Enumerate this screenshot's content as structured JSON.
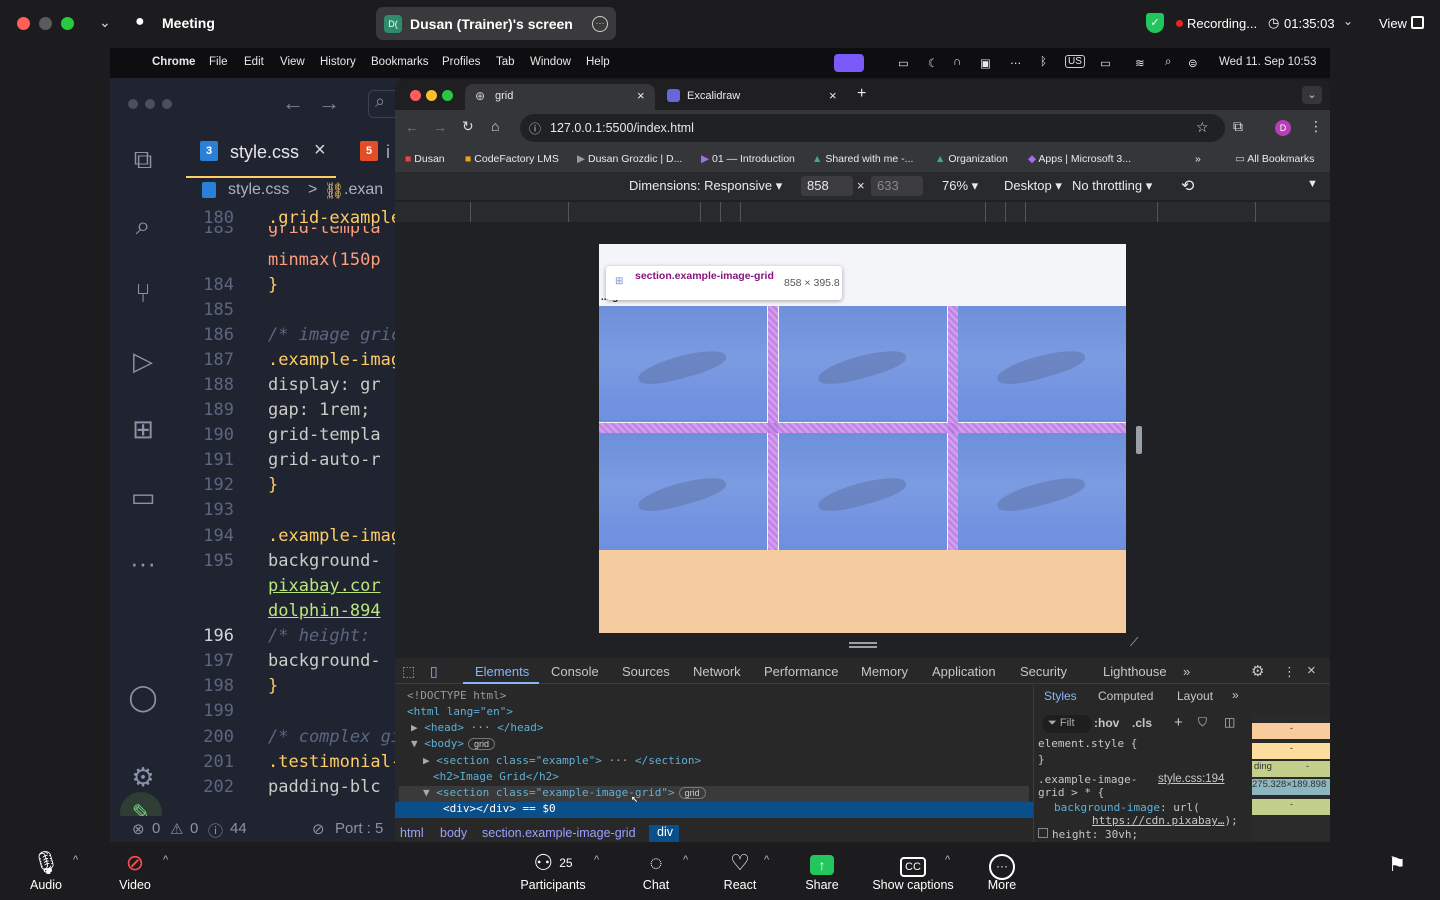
{
  "zoom": {
    "meeting_label": "Meeting",
    "screen_share_label": "Dusan (Trainer)'s screen",
    "recording_label": "Recording...",
    "timer": "01:35:03",
    "view_label": "View",
    "bottom": {
      "audio": "Audio",
      "video": "Video",
      "participants": "Participants",
      "participants_count": "25",
      "chat": "Chat",
      "react": "React",
      "share": "Share",
      "captions": "Show captions",
      "more": "More"
    }
  },
  "mac_menubar": {
    "app": "Chrome",
    "menus": [
      "File",
      "Edit",
      "View",
      "History",
      "Bookmarks",
      "Profiles",
      "Tab",
      "Window",
      "Help"
    ],
    "datetime": "Wed 11. Sep  10:53"
  },
  "vscode": {
    "tabs": [
      {
        "label": "style.css"
      },
      {
        "label": "i"
      }
    ],
    "breadcrumb_file": "style.css",
    "breadcrumb_sep": ">",
    "breadcrumb_symbol": ".exan",
    "lines": [
      {
        "n": "180",
        "code": ".grid-example"
      },
      {
        "n": "183",
        "code": "  grid-templa"
      },
      {
        "n": "",
        "code": "  minmax(150p"
      },
      {
        "n": "184",
        "code": "}"
      },
      {
        "n": "185",
        "code": ""
      },
      {
        "n": "186",
        "code": "/* image gric"
      },
      {
        "n": "187",
        "code": ".example-imag"
      },
      {
        "n": "188",
        "code": "  display: gr"
      },
      {
        "n": "189",
        "code": "  gap: 1rem;"
      },
      {
        "n": "190",
        "code": "  grid-templa"
      },
      {
        "n": "191",
        "code": "  grid-auto-r"
      },
      {
        "n": "192",
        "code": "}"
      },
      {
        "n": "193",
        "code": ""
      },
      {
        "n": "194",
        "code": ".example-imag"
      },
      {
        "n": "195",
        "code": "  background-"
      },
      {
        "n": "",
        "code": "  pixabay.cor"
      },
      {
        "n": "",
        "code": "  dolphin-894"
      },
      {
        "n": "196",
        "code": "  /* height: "
      },
      {
        "n": "197",
        "code": "  background-"
      },
      {
        "n": "198",
        "code": "}"
      },
      {
        "n": "199",
        "code": ""
      },
      {
        "n": "200",
        "code": "/* complex gi"
      },
      {
        "n": "201",
        "code": ".testimonial-"
      },
      {
        "n": "202",
        "code": "  padding-blc"
      }
    ],
    "status": {
      "errors": "0",
      "warnings": "0",
      "info": "44",
      "port": "Port : 5"
    }
  },
  "chrome": {
    "tabs": [
      {
        "label": "grid"
      },
      {
        "label": "Excalidraw"
      }
    ],
    "url": "127.0.0.1:5500/index.html",
    "profile_initial": "D",
    "bookmarks": [
      "Dusan",
      "CodeFactory LMS",
      "Dusan Grozdic | D...",
      "01 — Introduction",
      "Shared with me -...",
      "Organization",
      "Apps | Microsoft 3..."
    ],
    "all_bookmarks": "All Bookmarks",
    "device_toolbar": {
      "dimensions_label": "Dimensions: Responsive",
      "width": "858",
      "height": "633",
      "zoom": "76%",
      "device": "Desktop",
      "throttle": "No throttling"
    },
    "page": {
      "heading_partial": "... ge Grid",
      "tooltip_selector": "section.example-image-grid",
      "tooltip_size": "858 × 395.8"
    },
    "devtools": {
      "tabs": [
        "Elements",
        "Console",
        "Sources",
        "Network",
        "Performance",
        "Memory",
        "Application",
        "Security",
        "Lighthouse"
      ],
      "dom": [
        "<!DOCTYPE html>",
        "<html lang=\"en\">",
        "<head>",
        "</head>",
        "<body>",
        "<section class=\"example\">",
        "</section>",
        "<h2>Image Grid</h2>",
        "<section class=\"example-image-grid\">",
        "<div></div> == $0"
      ],
      "badge_grid": "grid",
      "crumbs": [
        "html",
        "body",
        "section.example-image-grid",
        "div"
      ],
      "styles_tabs": [
        "Styles",
        "Computed",
        "Layout"
      ],
      "filter_placeholder": "Filt",
      "hov": ":hov",
      "cls": ".cls",
      "element_style": "element.style {",
      "close_brace": "}",
      "rule_selector": ".example-image-grid > * {",
      "rule_source": "style.css:194",
      "rule_prop": "background-image",
      "rule_value_prefix": "url(",
      "rule_url": "https://cdn.pixabay…",
      "rule_value_suffix": ");",
      "rule_prop2": "height: 30vh;",
      "box_values": [
        "-",
        "-",
        "ding",
        "-",
        "275.328×189.898",
        "-"
      ]
    }
  },
  "colors": {
    "accent_blue": "#8ab4f8",
    "recording_red": "#e02828",
    "share_green": "#22c55e",
    "grid_overlay": "#b46be0"
  }
}
